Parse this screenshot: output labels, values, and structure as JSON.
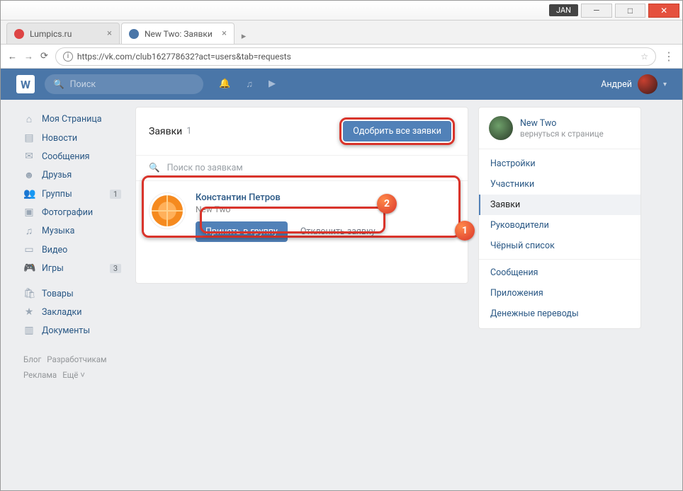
{
  "titlebar": {
    "month": "JAN",
    "min": "—",
    "max": "□",
    "close": "✕"
  },
  "tabs": [
    {
      "title": "Lumpics.ru"
    },
    {
      "title": "New Two: Заявки"
    }
  ],
  "addressbar": {
    "url": "https://vk.com/club162778632?act=users&tab=requests"
  },
  "vk": {
    "search_placeholder": "Поиск",
    "username": "Андрей"
  },
  "leftnav": {
    "items": [
      {
        "icon": "⌂",
        "label": "Моя Страница"
      },
      {
        "icon": "▤",
        "label": "Новости"
      },
      {
        "icon": "✉",
        "label": "Сообщения"
      },
      {
        "icon": "☻",
        "label": "Друзья"
      },
      {
        "icon": "👥",
        "label": "Группы",
        "badge": "1"
      },
      {
        "icon": "▣",
        "label": "Фотографии"
      },
      {
        "icon": "♫",
        "label": "Музыка"
      },
      {
        "icon": "▭",
        "label": "Видео"
      },
      {
        "icon": "🎮",
        "label": "Игры",
        "badge": "3"
      }
    ],
    "items2": [
      {
        "icon": "🛍",
        "label": "Товары"
      },
      {
        "icon": "★",
        "label": "Закладки"
      },
      {
        "icon": "▥",
        "label": "Документы"
      }
    ],
    "footer": [
      "Блог",
      "Разработчикам",
      "Реклама",
      "Ещё ˅"
    ]
  },
  "panel": {
    "title": "Заявки",
    "count": "1",
    "approve_all": "Одобрить все заявки",
    "search_placeholder": "Поиск по заявкам",
    "request": {
      "name": "Константин Петров",
      "sub": "New Two",
      "accept": "Принять в группу",
      "decline": "Отклонить заявку"
    }
  },
  "right": {
    "group_name": "New Two",
    "back": "вернуться к странице",
    "menu": [
      "Настройки",
      "Участники",
      "Заявки",
      "Руководители",
      "Чёрный список"
    ],
    "menu2": [
      "Сообщения",
      "Приложения",
      "Денежные переводы"
    ],
    "active_index": 2
  },
  "annotations": {
    "n1": "1",
    "n2": "2"
  }
}
